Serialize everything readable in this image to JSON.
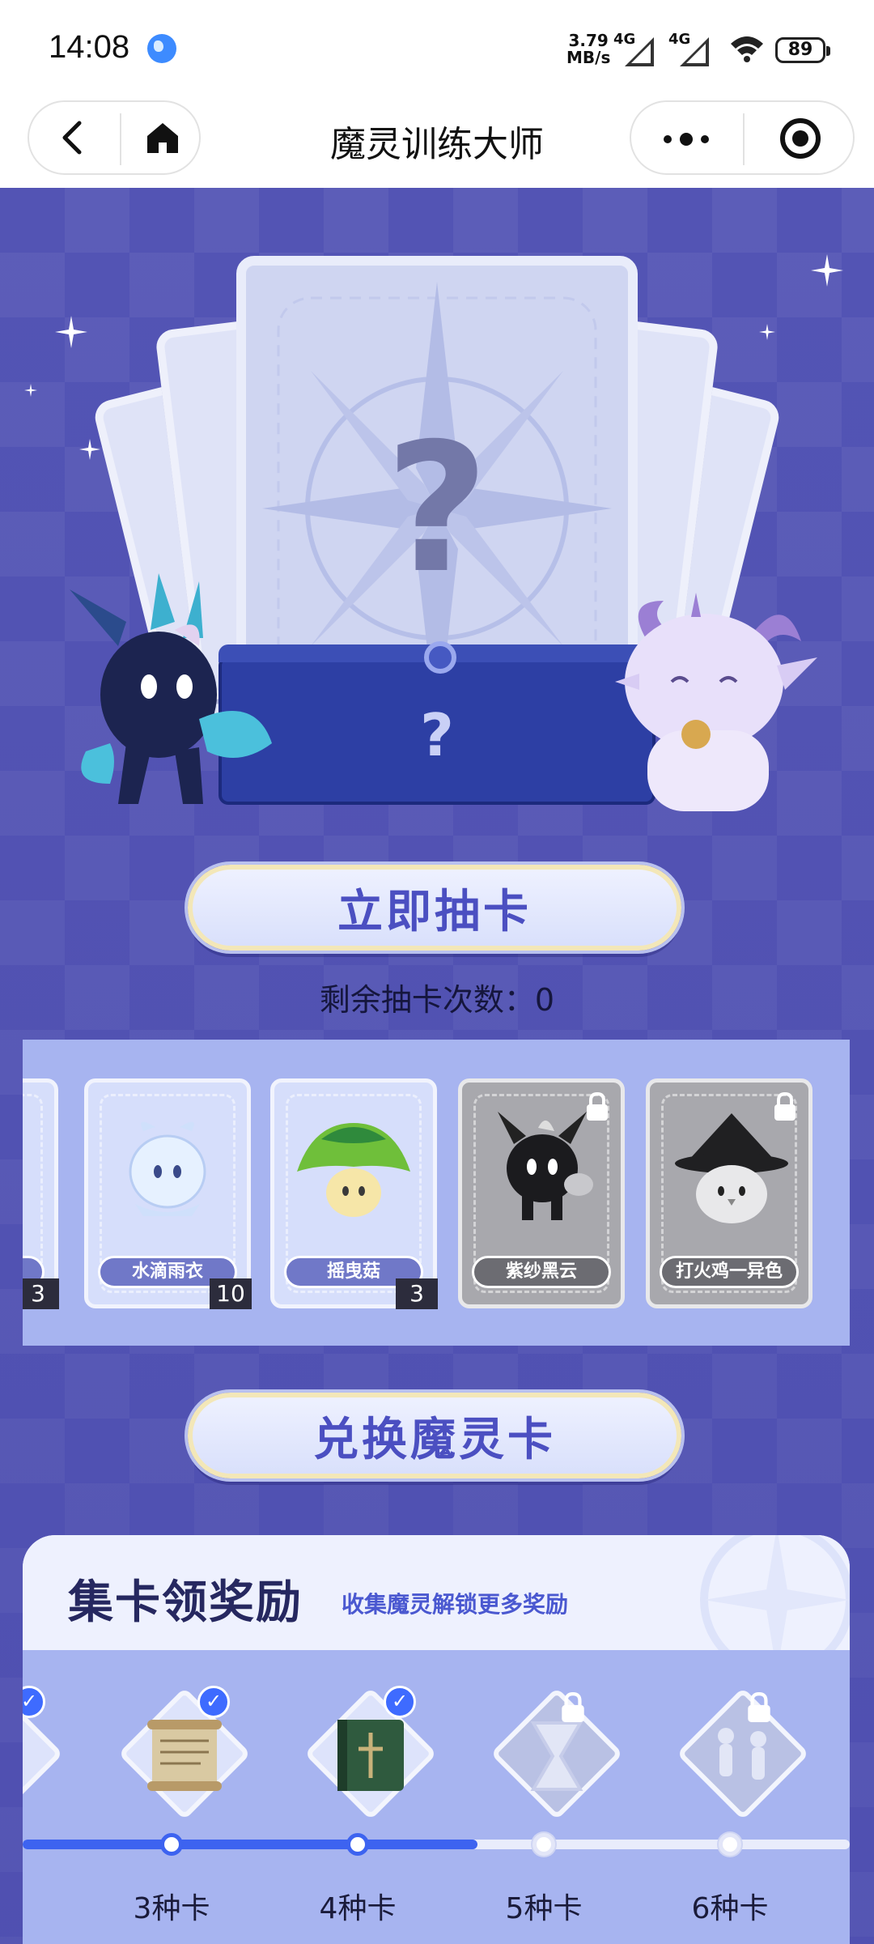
{
  "status_bar": {
    "time": "14:08",
    "net_speed_value": "3.79",
    "net_speed_unit": "MB/s",
    "signal_1": "4G",
    "signal_2": "4G",
    "battery": "89"
  },
  "nav": {
    "title": "魔灵训练大师",
    "back_icon": "chevron-left-icon",
    "home_icon": "home-icon",
    "more_icon": "more-dots-icon",
    "close_icon": "target-icon"
  },
  "draw": {
    "hidden_card_symbol": "?",
    "envelope_symbol": "?",
    "draw_button": "立即抽卡",
    "remaining_label": "剩余抽卡次数：",
    "remaining_value": "0"
  },
  "cards": [
    {
      "name": "",
      "count": "3",
      "locked": false
    },
    {
      "name": "水滴雨衣",
      "count": "10",
      "locked": false
    },
    {
      "name": "摇曳菇",
      "count": "3",
      "locked": false
    },
    {
      "name": "紫纱黑云",
      "count": "",
      "locked": true
    },
    {
      "name": "打火鸡一异色",
      "count": "",
      "locked": true
    }
  ],
  "exchange_button": "兑换魔灵卡",
  "rewards": {
    "title": "集卡领奖励",
    "subtitle": "收集魔灵解锁更多奖励",
    "steps": [
      {
        "label": "3种卡",
        "claimed": true
      },
      {
        "label": "4种卡",
        "claimed": true
      },
      {
        "label": "5种卡",
        "claimed": false
      },
      {
        "label": "6种卡",
        "claimed": false
      }
    ],
    "progress_fraction": 0.55
  },
  "colors": {
    "background": "#5354b4",
    "accent_blue": "#3d63f0",
    "button_text": "#4b4fc1"
  }
}
